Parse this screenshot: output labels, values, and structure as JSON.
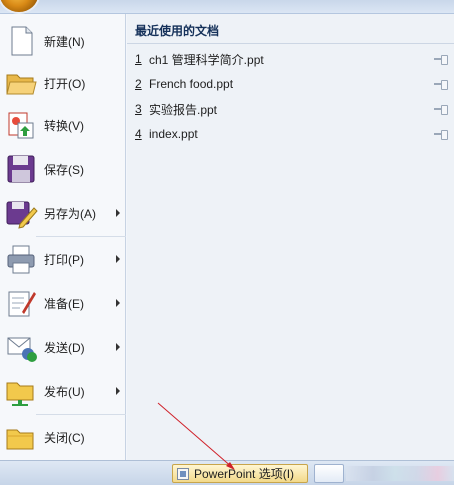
{
  "menu": {
    "items": [
      {
        "label": "新建(N)",
        "icon": "new-document-icon",
        "has_submenu": false
      },
      {
        "label": "打开(O)",
        "icon": "open-folder-icon",
        "has_submenu": false
      },
      {
        "label": "转换(V)",
        "icon": "convert-icon",
        "has_submenu": false
      },
      {
        "label": "保存(S)",
        "icon": "save-floppy-icon",
        "has_submenu": false
      },
      {
        "label": "另存为(A)",
        "icon": "save-as-icon",
        "has_submenu": true
      },
      {
        "label": "打印(P)",
        "icon": "printer-icon",
        "has_submenu": true
      },
      {
        "label": "准备(E)",
        "icon": "prepare-icon",
        "has_submenu": true
      },
      {
        "label": "发送(D)",
        "icon": "send-icon",
        "has_submenu": true
      },
      {
        "label": "发布(U)",
        "icon": "publish-icon",
        "has_submenu": true
      },
      {
        "label": "关闭(C)",
        "icon": "close-folder-icon",
        "has_submenu": false
      }
    ]
  },
  "recent": {
    "header": "最近使用的文档",
    "items": [
      {
        "num": "1",
        "name": "ch1 管理科学简介.ppt"
      },
      {
        "num": "2",
        "name": "French food.ppt"
      },
      {
        "num": "3",
        "name": "实验报告.ppt"
      },
      {
        "num": "4",
        "name": "index.ppt"
      }
    ]
  },
  "bottom": {
    "options_label": "PowerPoint 选项(I)"
  },
  "colors": {
    "accent_arrow": "#d0212a",
    "panel_bg": "#eef2f7",
    "header_text": "#15315a"
  }
}
